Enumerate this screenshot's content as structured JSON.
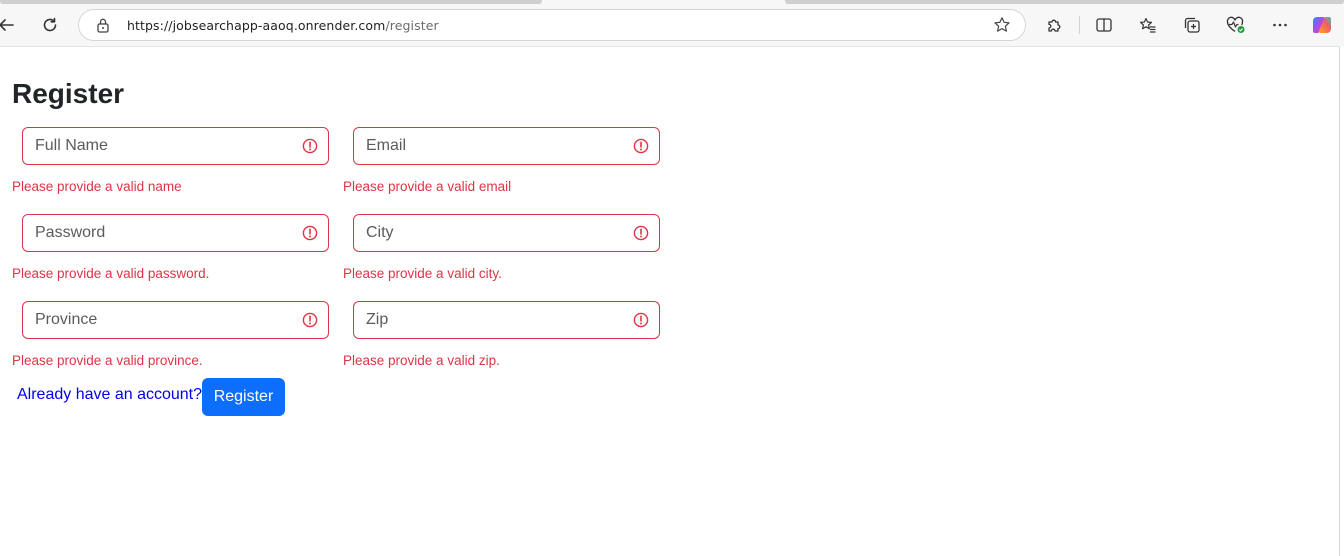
{
  "browser": {
    "url_host": "https://jobsearchapp-aaoq.onrender.com",
    "url_path": "/register"
  },
  "page": {
    "title": "Register"
  },
  "form": {
    "full_name": {
      "placeholder": "Full Name",
      "value": "",
      "error": "Please provide a valid name"
    },
    "email": {
      "placeholder": "Email",
      "value": "",
      "error": "Please provide a valid email"
    },
    "password": {
      "placeholder": "Password",
      "value": "",
      "error": "Please provide a valid password."
    },
    "city": {
      "placeholder": "City",
      "value": "",
      "error": "Please provide a valid city."
    },
    "province": {
      "placeholder": "Province",
      "value": "",
      "error": "Please provide a valid province."
    },
    "zip": {
      "placeholder": "Zip",
      "value": "",
      "error": "Please provide a valid zip."
    },
    "login_link": "Already have an account?",
    "submit_label": "Register"
  },
  "colors": {
    "error": "#dc3545",
    "primary": "#0d6efd",
    "link": "#0000ee"
  },
  "icons": {
    "back": "arrow-left-icon",
    "refresh": "refresh-icon",
    "lock": "lock-icon",
    "favorite": "star-icon",
    "extensions": "puzzle-icon",
    "split": "split-screen-icon",
    "favorites": "favorites-icon",
    "collections": "collections-icon",
    "health": "heart-pulse-icon",
    "more": "more-icon",
    "copilot": "copilot-icon",
    "field_error": "exclamation-circle-icon"
  }
}
